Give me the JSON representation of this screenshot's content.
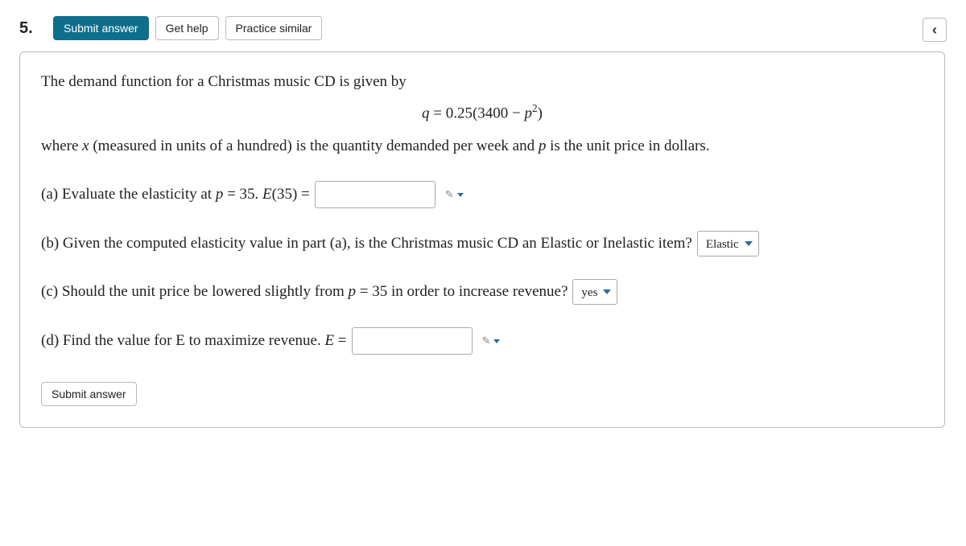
{
  "question_number": "5.",
  "toolbar": {
    "submit_label": "Submit answer",
    "help_label": "Get help",
    "practice_label": "Practice similar"
  },
  "chevron_glyph": "‹",
  "body": {
    "intro": "The demand function for a Christmas music CD is given by",
    "equation_lhs": "q",
    "equation_eq": " = ",
    "equation_rhs_num": "0.25(3400 − ",
    "equation_rhs_var": "p",
    "equation_rhs_exp": "2",
    "equation_rhs_close": ")",
    "where_1": "where ",
    "where_x": "x",
    "where_2": " (measured in units of a hundred) is the quantity demanded per week and ",
    "where_p": "p",
    "where_3": " is the unit price in dollars."
  },
  "parts": {
    "a_1": "(a) Evaluate the elasticity at ",
    "a_p": "p",
    "a_2": " = 35. ",
    "a_E": "E",
    "a_3": "(35) = ",
    "b_text": "(b) Given the computed elasticity value in part (a), is the Christmas music CD an Elastic or Inelastic item?",
    "b_selected": "Elastic",
    "c_1": "(c) Should the unit price be lowered slightly from ",
    "c_p": "p",
    "c_2": " = 35 in order to increase revenue?",
    "c_selected": "yes",
    "d_1": "(d) Find the value for E to maximize revenue. ",
    "d_E": "E",
    "d_2": " = "
  },
  "inputs": {
    "a_value": "",
    "d_value": ""
  },
  "footer": {
    "submit_label": "Submit answer"
  },
  "icons": {
    "pencil_glyph": "✎"
  }
}
